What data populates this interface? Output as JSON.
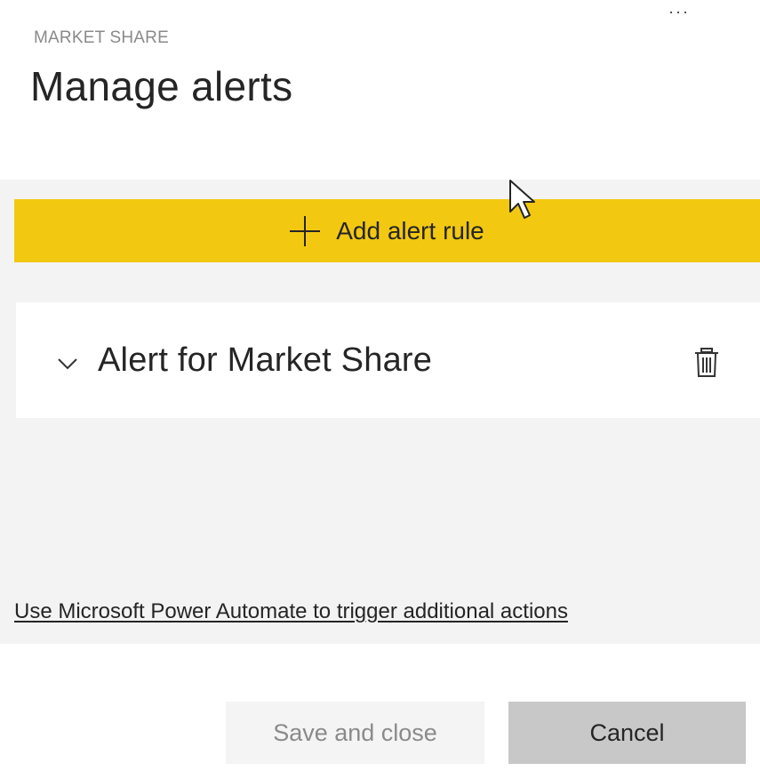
{
  "header": {
    "more_label": "···",
    "eyebrow": "MARKET SHARE",
    "title": "Manage alerts"
  },
  "toolbar": {
    "add_rule_label": "Add alert rule",
    "add_rule_icon": "plus-icon",
    "accent_color": "#f2c811"
  },
  "alerts": [
    {
      "title": "Alert for Market Share",
      "expand_icon": "chevron-down-icon",
      "delete_icon": "trash-icon"
    }
  ],
  "footer": {
    "flow_link": "Use Microsoft Power Automate to trigger additional actions",
    "save_label": "Save and close",
    "cancel_label": "Cancel"
  }
}
